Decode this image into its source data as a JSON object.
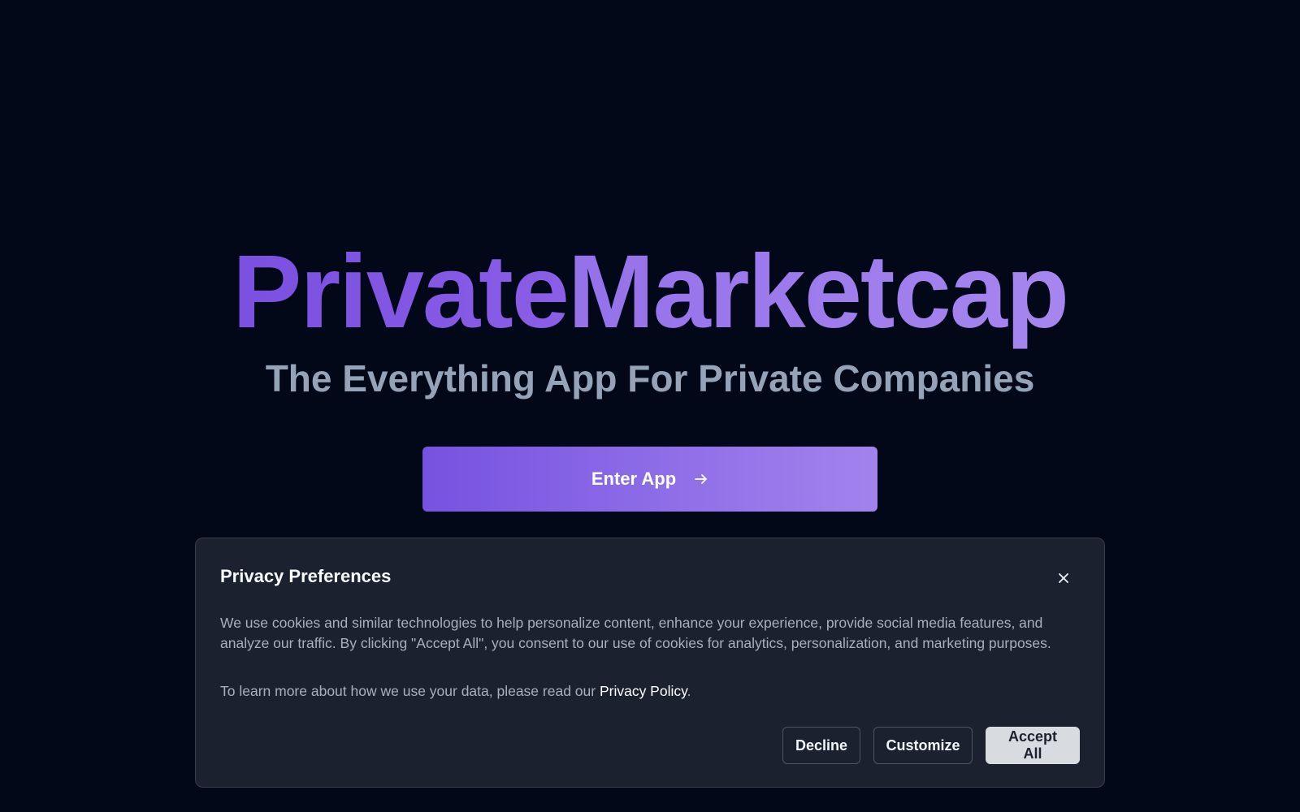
{
  "hero": {
    "brand_part1": "Private",
    "brand_part2": "Marketcap",
    "tagline": "The Everything App For Private Companies",
    "enter_label": "Enter App"
  },
  "cookie_banner": {
    "title": "Privacy Preferences",
    "body": "We use cookies and similar technologies to help personalize content, enhance your experience, provide social media features, and analyze our traffic. By clicking \"Accept All\", you consent to our use of cookies for analytics, personalization, and marketing purposes.",
    "learn_prefix": "To learn more about how we use your data, please read our ",
    "policy_link": "Privacy Policy",
    "learn_suffix": ".",
    "decline_label": "Decline",
    "customize_label": "Customize",
    "accept_label": "Accept All"
  },
  "icons": {
    "enter": "arrow-right-icon",
    "close": "close-icon"
  },
  "colors": {
    "background": "#020817",
    "brand_purple": "#7b4fe0",
    "brand_light_purple": "#a686ee",
    "tagline": "#94a3b8",
    "card": "#1c2130",
    "accept_button": "#d8dbe0"
  }
}
